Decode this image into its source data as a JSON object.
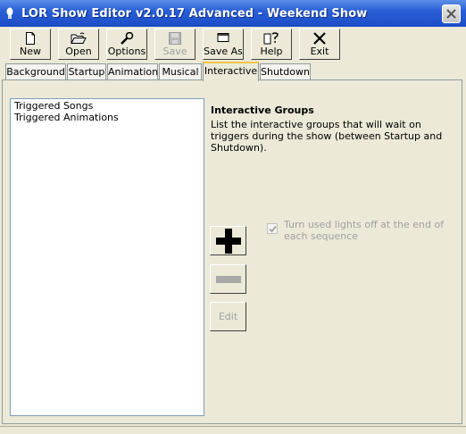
{
  "window": {
    "title": "LOR Show Editor v2.0.17 Advanced - Weekend Show"
  },
  "toolbar": [
    {
      "label": "New",
      "icon": "new-document-icon",
      "enabled": true
    },
    {
      "label": "Open",
      "icon": "open-folder-icon",
      "enabled": true
    },
    {
      "label": "Options",
      "icon": "wrench-icon",
      "enabled": true
    },
    {
      "label": "Save",
      "icon": "floppy-disk-icon",
      "enabled": false
    },
    {
      "label": "Save As",
      "icon": "window-icon",
      "enabled": true
    },
    {
      "label": "Help",
      "icon": "help-icon",
      "enabled": true
    },
    {
      "label": "Exit",
      "icon": "x-icon",
      "enabled": true
    }
  ],
  "tabs": [
    {
      "label": "Background"
    },
    {
      "label": "Startup"
    },
    {
      "label": "Animation"
    },
    {
      "label": "Musical"
    },
    {
      "label": "Interactive",
      "active": true
    },
    {
      "label": "Shutdown"
    }
  ],
  "groups_list": [
    "Triggered Songs",
    "Triggered Animations"
  ],
  "info": {
    "heading": "Interactive Groups",
    "description": "List the interactive groups that will wait on triggers during the show (between Startup and Shutdown)."
  },
  "actions": {
    "add": "add-icon",
    "remove": "remove-icon",
    "edit_label": "Edit"
  },
  "option": {
    "label": "Turn used lights off at the end of each sequence",
    "checked": true,
    "enabled": false
  },
  "colors": {
    "title_bar": "#2a5fd6",
    "face": "#ece9d8",
    "active_tab_accent": "#fcc54a",
    "disabled_text": "#a0a0a0"
  }
}
